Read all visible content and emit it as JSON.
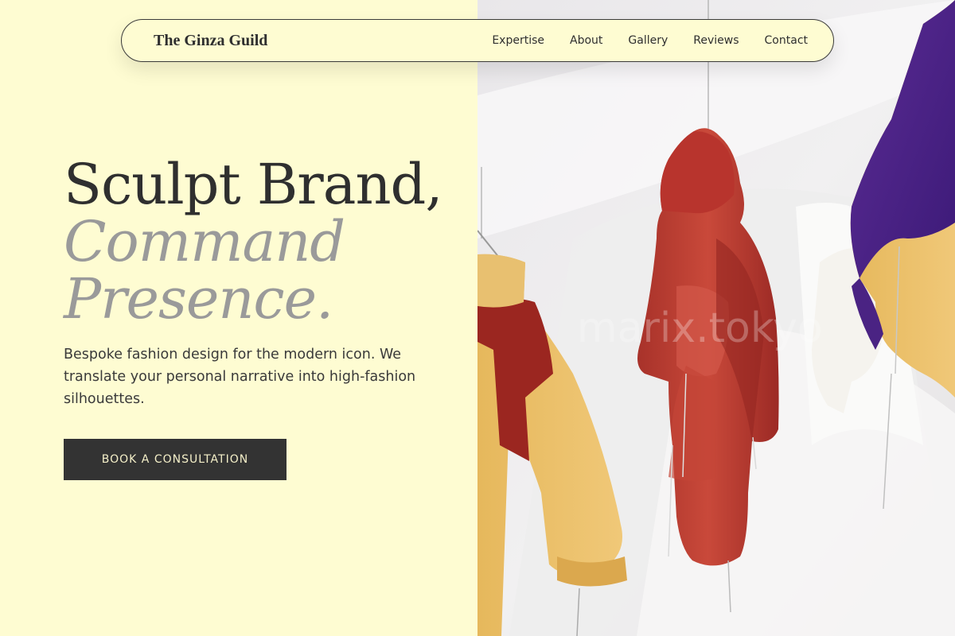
{
  "nav": {
    "brand": "The Ginza Guild",
    "links": [
      "Expertise",
      "About",
      "Gallery",
      "Reviews",
      "Contact"
    ]
  },
  "hero": {
    "headline_line1": "Sculpt Brand,",
    "headline_line2": "Command",
    "headline_line3": "Presence.",
    "subtitle": "Bespoke fashion design for the modern icon. We translate your personal narrative into high-fashion silhouettes.",
    "cta_label": "BOOK A CONSULTATION"
  },
  "photo": {
    "watermark": "marix.tokyo",
    "subject": "hanging windbreaker jackets"
  },
  "colors": {
    "background": "#fefcd2",
    "text_dark": "#2f2f2f",
    "text_muted": "#9a9a9a",
    "button_bg": "#333333",
    "button_text": "#f4efc8"
  }
}
